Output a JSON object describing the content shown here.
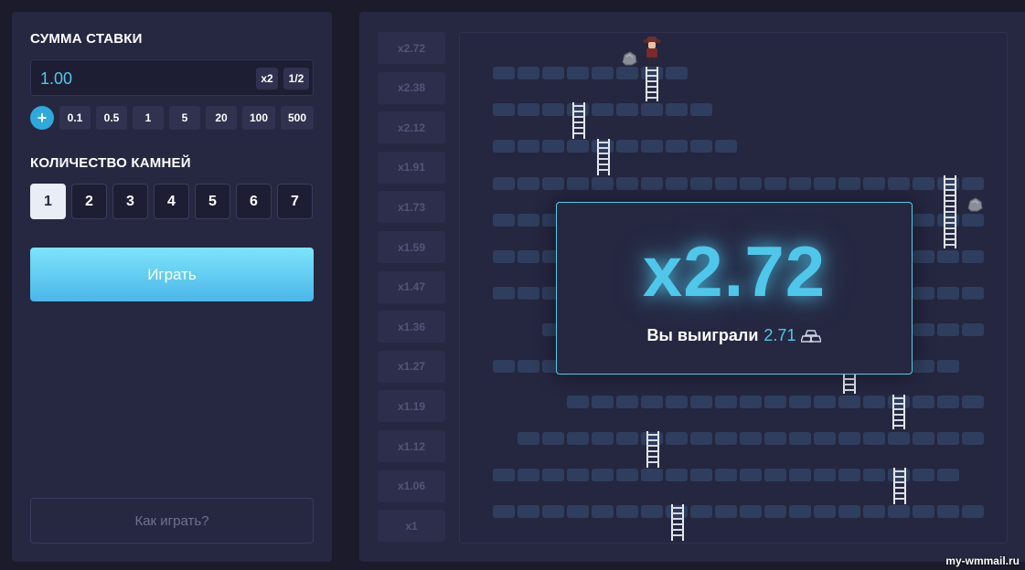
{
  "bet": {
    "title": "СУММА СТАВКИ",
    "value": "1.00",
    "double_label": "x2",
    "half_label": "1/2",
    "plus_label": "+",
    "quick_amounts": [
      "0.1",
      "0.5",
      "1",
      "5",
      "20",
      "100",
      "500"
    ]
  },
  "stones": {
    "title": "КОЛИЧЕСТВО КАМНЕЙ",
    "options": [
      "1",
      "2",
      "3",
      "4",
      "5",
      "6",
      "7"
    ],
    "selected": "1"
  },
  "play_label": "Играть",
  "howto_label": "Как играть?",
  "multipliers": [
    "x2.72",
    "x2.38",
    "x2.12",
    "x1.91",
    "x1.73",
    "x1.59",
    "x1.47",
    "x1.36",
    "x1.27",
    "x1.19",
    "x1.12",
    "x1.06",
    "x1"
  ],
  "result": {
    "multiplier": "x2.72",
    "win_label": "Вы выиграли",
    "win_amount": "2.71",
    "currency_icon": "gold-bars-icon"
  },
  "colors": {
    "accent": "#4fc7ea",
    "panel": "#262741",
    "background": "#1b1b2b",
    "block": "#2f3e5e"
  },
  "watermark": "my-wmmail.ru"
}
